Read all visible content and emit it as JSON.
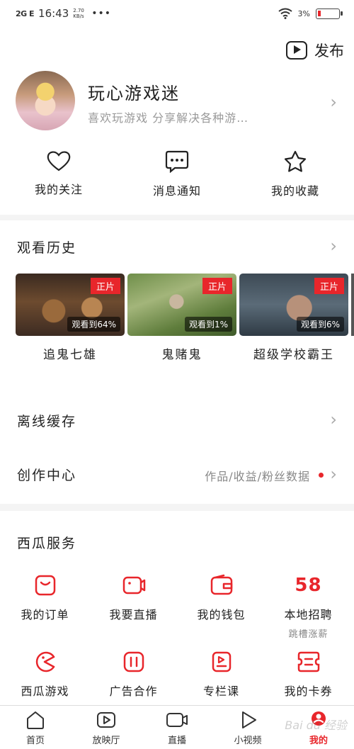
{
  "status": {
    "network": "2G E",
    "time": "16:43",
    "speed": "2.70 KB/s",
    "dots": "•••",
    "battery": "3%"
  },
  "header": {
    "publish_label": "发布",
    "publish_icon": "video-publish-icon"
  },
  "profile": {
    "username": "玩心游戏迷",
    "bio": "喜欢玩游戏 分享解决各种游…",
    "chevron": "›"
  },
  "quick_actions": [
    {
      "label": "我的关注",
      "icon": "heart-icon"
    },
    {
      "label": "消息通知",
      "icon": "message-icon"
    },
    {
      "label": "我的收藏",
      "icon": "star-icon"
    }
  ],
  "history": {
    "title": "观看历史",
    "chevron": "›",
    "items": [
      {
        "title": "追鬼七雄",
        "tag": "正片",
        "progress": "观看到64%"
      },
      {
        "title": "鬼赌鬼",
        "tag": "正片",
        "progress": "观看到1%"
      },
      {
        "title": "超级学校霸王",
        "tag": "正片",
        "progress": "观看到6%"
      }
    ]
  },
  "offline": {
    "label": "离线缓存",
    "chevron": "›"
  },
  "creator": {
    "label": "创作中心",
    "sub": "作品/收益/粉丝数据",
    "chevron": "›"
  },
  "services": {
    "title": "西瓜服务",
    "accent": "#e8262b",
    "items": [
      {
        "label": "我的订单",
        "icon": "order-icon",
        "sub": ""
      },
      {
        "label": "我要直播",
        "icon": "live-camera-icon",
        "sub": ""
      },
      {
        "label": "我的钱包",
        "icon": "wallet-icon",
        "sub": ""
      },
      {
        "label": "本地招聘",
        "icon": "58-icon",
        "logo": "58",
        "sub": "跳槽涨薪"
      },
      {
        "label": "西瓜游戏",
        "icon": "game-icon",
        "sub": ""
      },
      {
        "label": "广告合作",
        "icon": "ad-icon",
        "sub": ""
      },
      {
        "label": "专栏课",
        "icon": "course-icon",
        "sub": ""
      },
      {
        "label": "我的卡券",
        "icon": "coupon-icon",
        "sub": ""
      }
    ]
  },
  "tabbar": [
    {
      "label": "首页",
      "icon": "home-icon",
      "active": false
    },
    {
      "label": "放映厅",
      "icon": "cinema-icon",
      "active": false
    },
    {
      "label": "直播",
      "icon": "live-icon",
      "active": false
    },
    {
      "label": "小视频",
      "icon": "short-video-icon",
      "active": false
    },
    {
      "label": "我的",
      "icon": "profile-icon",
      "active": true
    }
  ],
  "watermark": "Bai du 经验"
}
